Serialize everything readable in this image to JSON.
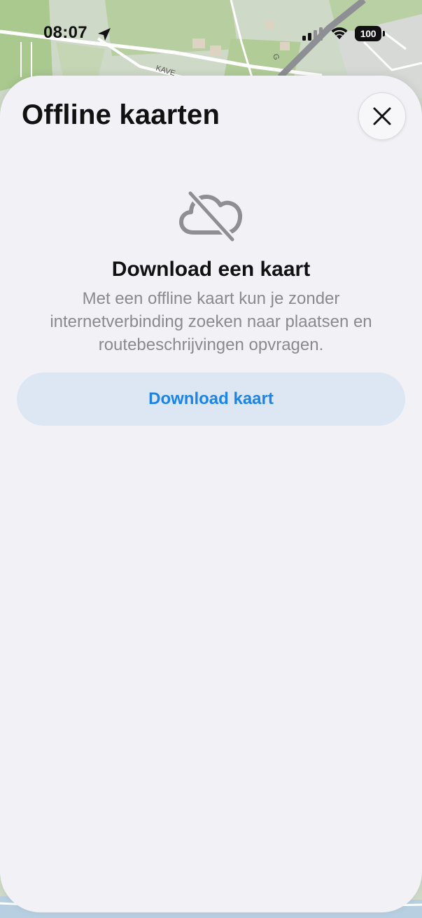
{
  "status_bar": {
    "time": "08:07",
    "battery": "100",
    "location_icon": "location-arrow-icon",
    "signal_icon": "cellular-signal-icon",
    "wifi_icon": "wifi-icon"
  },
  "map": {
    "street_label": "KAVE",
    "street_label_2": "G"
  },
  "sheet": {
    "title": "Offline kaarten",
    "close_icon": "close-icon",
    "empty_state": {
      "icon": "cloud-slash-icon",
      "title": "Download een kaart",
      "description": "Met een offline kaart kun je zonder internetverbinding zoeken naar plaatsen en routebeschrijvingen opvragen."
    },
    "download_button_label": "Download kaart"
  },
  "colors": {
    "accent": "#1a84e8",
    "button_background": "#dde7f4",
    "sheet_background": "#f2f2f6",
    "secondary_text": "#8a8a8e"
  }
}
